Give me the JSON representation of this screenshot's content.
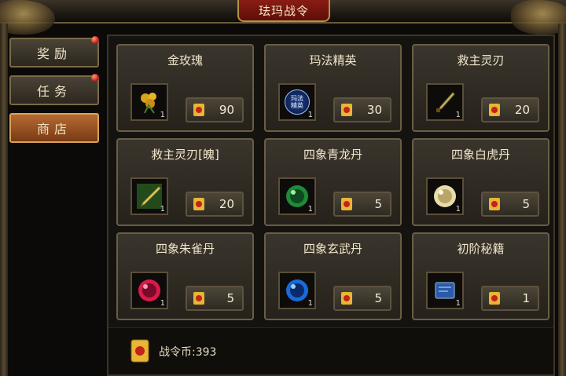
{
  "window": {
    "title": "珐玛战令"
  },
  "sidebar": {
    "tabs": [
      {
        "label": "奖励",
        "badge": true,
        "active": false
      },
      {
        "label": "任务",
        "badge": true,
        "active": false
      },
      {
        "label": "商店",
        "badge": false,
        "active": true
      }
    ]
  },
  "shop": {
    "items": [
      {
        "name": "金玫瑰",
        "qty": "1",
        "price": "90",
        "icon": "golden-rose-icon"
      },
      {
        "name": "玛法精英",
        "qty": "1",
        "price": "30",
        "icon": "mafa-elite-badge-icon",
        "badge_text": "玛法精英"
      },
      {
        "name": "救主灵刃",
        "qty": "1",
        "price": "20",
        "icon": "spirit-blade-icon"
      },
      {
        "name": "救主灵刃[魄]",
        "qty": "1",
        "price": "20",
        "icon": "spirit-blade-soul-icon"
      },
      {
        "name": "四象青龙丹",
        "qty": "1",
        "price": "5",
        "icon": "green-dragon-pill-icon"
      },
      {
        "name": "四象白虎丹",
        "qty": "1",
        "price": "5",
        "icon": "white-tiger-pill-icon"
      },
      {
        "name": "四象朱雀丹",
        "qty": "1",
        "price": "5",
        "icon": "vermilion-bird-pill-icon"
      },
      {
        "name": "四象玄武丹",
        "qty": "1",
        "price": "5",
        "icon": "black-tortoise-pill-icon"
      },
      {
        "name": "初阶秘籍",
        "qty": "1",
        "price": "1",
        "icon": "beginner-manual-icon"
      }
    ]
  },
  "footer": {
    "currency_label": "战令币:393"
  },
  "colors": {
    "accent_red": "#8a1c14",
    "frame_gold": "#b8923c",
    "active_tab": "#b56a32"
  }
}
